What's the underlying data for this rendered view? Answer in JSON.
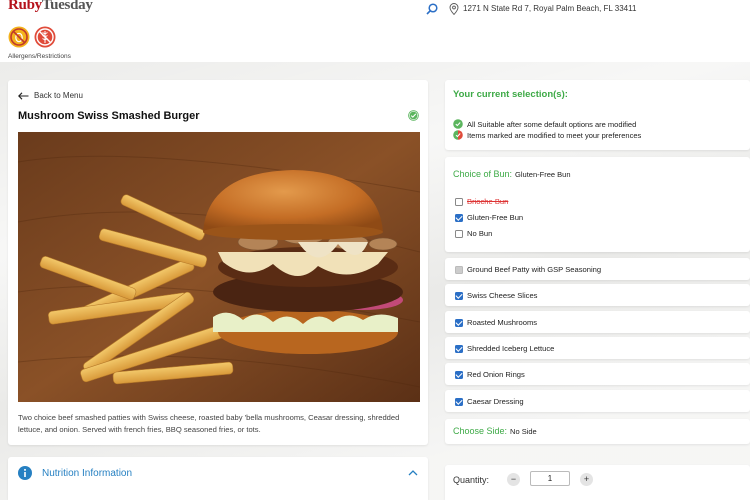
{
  "brand": {
    "name_part1": "Ruby",
    "name_part2": "Tuesday"
  },
  "header": {
    "address": "1271 N State Rd 7, Royal Palm Beach, FL 33411",
    "allergen_label": "Allergens/Restrictions",
    "allergen_icons": [
      "no-egg-icon",
      "no-wheat-icon"
    ]
  },
  "item": {
    "back_label": "Back to Menu",
    "title": "Mushroom Swiss Smashed Burger",
    "description": "Two choice beef smashed patties with Swiss cheese, roasted baby 'bella mushrooms, Ceasar dressing, shredded lettuce, and onion. Served with french fries, BBQ seasoned fries, or tots."
  },
  "nutrition": {
    "label": "Nutrition Information"
  },
  "selection": {
    "title": "Your current selection(s):",
    "rows": [
      {
        "icon": "green-check-badge-icon",
        "text": "All Suitable after some default options are modified"
      },
      {
        "icon": "modified-badge-icon",
        "text": "Items marked are modified to meet your preferences"
      }
    ]
  },
  "bun": {
    "label": "Choice of Bun:",
    "value": "Gluten-Free Bun",
    "options": [
      {
        "label": "Brioche Bun",
        "checked": false,
        "struck": true
      },
      {
        "label": "Gluten-Free Bun",
        "checked": true,
        "struck": false
      },
      {
        "label": "No Bun",
        "checked": false,
        "struck": false
      }
    ]
  },
  "ingredients": [
    {
      "label": "Ground Beef Patty with GSP Seasoning",
      "checked": false,
      "disabled": true
    },
    {
      "label": "Swiss Cheese Slices",
      "checked": true,
      "disabled": false
    },
    {
      "label": "Roasted Mushrooms",
      "checked": true,
      "disabled": false
    },
    {
      "label": "Shredded Iceberg Lettuce",
      "checked": true,
      "disabled": false
    },
    {
      "label": "Red Onion Rings",
      "checked": true,
      "disabled": false
    },
    {
      "label": "Caesar Dressing",
      "checked": true,
      "disabled": false
    }
  ],
  "side": {
    "label": "Choose Side:",
    "value": "No Side"
  },
  "quantity": {
    "label": "Quantity:",
    "value": "1",
    "minus": "−",
    "plus": "+"
  },
  "colors": {
    "brand_red": "#b5121b",
    "accent_green": "#3eaa47",
    "link_blue": "#2680c2",
    "check_blue": "#2b6fc6"
  }
}
